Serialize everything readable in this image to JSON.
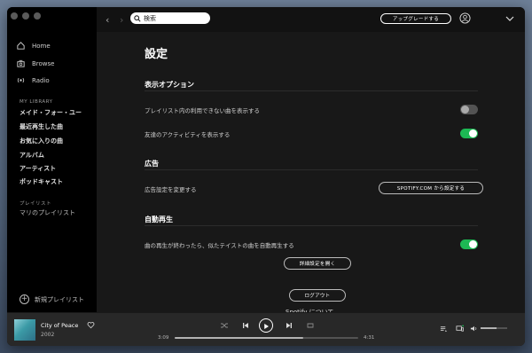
{
  "sidebar": {
    "nav": [
      {
        "label": "Home",
        "icon": "home-icon"
      },
      {
        "label": "Browse",
        "icon": "browse-icon"
      },
      {
        "label": "Radio",
        "icon": "radio-icon"
      }
    ],
    "library_heading": "MY LIBRARY",
    "library_items": [
      "メイド・フォー・ユー",
      "最近再生した曲",
      "お気に入りの曲",
      "アルバム",
      "アーティスト",
      "ポッドキャスト"
    ],
    "playlists_heading": "プレイリスト",
    "playlists": [
      "マリのプレイリスト"
    ],
    "new_playlist": "新規プレイリスト"
  },
  "topbar": {
    "search_value": "検索",
    "upgrade_label": "アップグレードする"
  },
  "settings": {
    "title": "設定",
    "display_section": "表示オプション",
    "display_rows": [
      {
        "label": "プレイリスト内の利用できない曲を表示する",
        "enabled": false
      },
      {
        "label": "友達のアクティビティを表示する",
        "enabled": true
      }
    ],
    "ads_section": "広告",
    "ads_row_label": "広告設定を変更する",
    "ads_button": "SPOTIFY.COM から設定する",
    "autoplay_section": "自動再生",
    "autoplay_row": {
      "label": "曲の再生が終わったら、似たテイストの曲を自動再生する",
      "enabled": true
    },
    "advanced_button": "詳細設定を開く",
    "logout_button": "ログアウト",
    "about_label": "Spotify について"
  },
  "player": {
    "track_title": "City of Peace",
    "track_sub": "2002",
    "elapsed": "3:09",
    "duration": "4:31",
    "progress": 0.7,
    "volume": 0.6
  },
  "colors": {
    "accent": "#1db954",
    "bg": "#181818",
    "sidebar": "#000000"
  }
}
